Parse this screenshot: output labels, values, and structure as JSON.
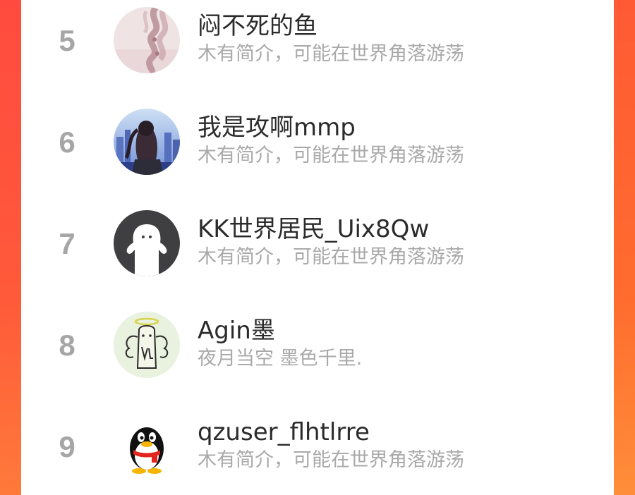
{
  "colors": {
    "rank_number": "#a6a6a6",
    "username": "#2b2b2b",
    "bio": "#a9a9a9",
    "frame_accent": "#ff5a3c"
  },
  "rankings": [
    {
      "rank": "5",
      "username": "闷不死的鱼",
      "bio": "木有简介，可能在世界角落游荡",
      "avatar_icon": "braided-hair-avatar"
    },
    {
      "rank": "6",
      "username": "我是攻啊mmp",
      "bio": "木有简介，可能在世界角落游荡",
      "avatar_icon": "city-girl-photo-avatar"
    },
    {
      "rank": "7",
      "username": "KK世界居民_Uix8Qw",
      "bio": "木有简介，可能在世界角落游荡",
      "avatar_icon": "default-ghost-avatar"
    },
    {
      "rank": "8",
      "username": "Agin墨",
      "bio": "夜月当空 墨色千里.",
      "avatar_icon": "angel-ghost-doodle-avatar"
    },
    {
      "rank": "9",
      "username": "qzuser_flhtlrre",
      "bio": "木有简介，可能在世界角落游荡",
      "avatar_icon": "qq-penguin-avatar"
    }
  ]
}
